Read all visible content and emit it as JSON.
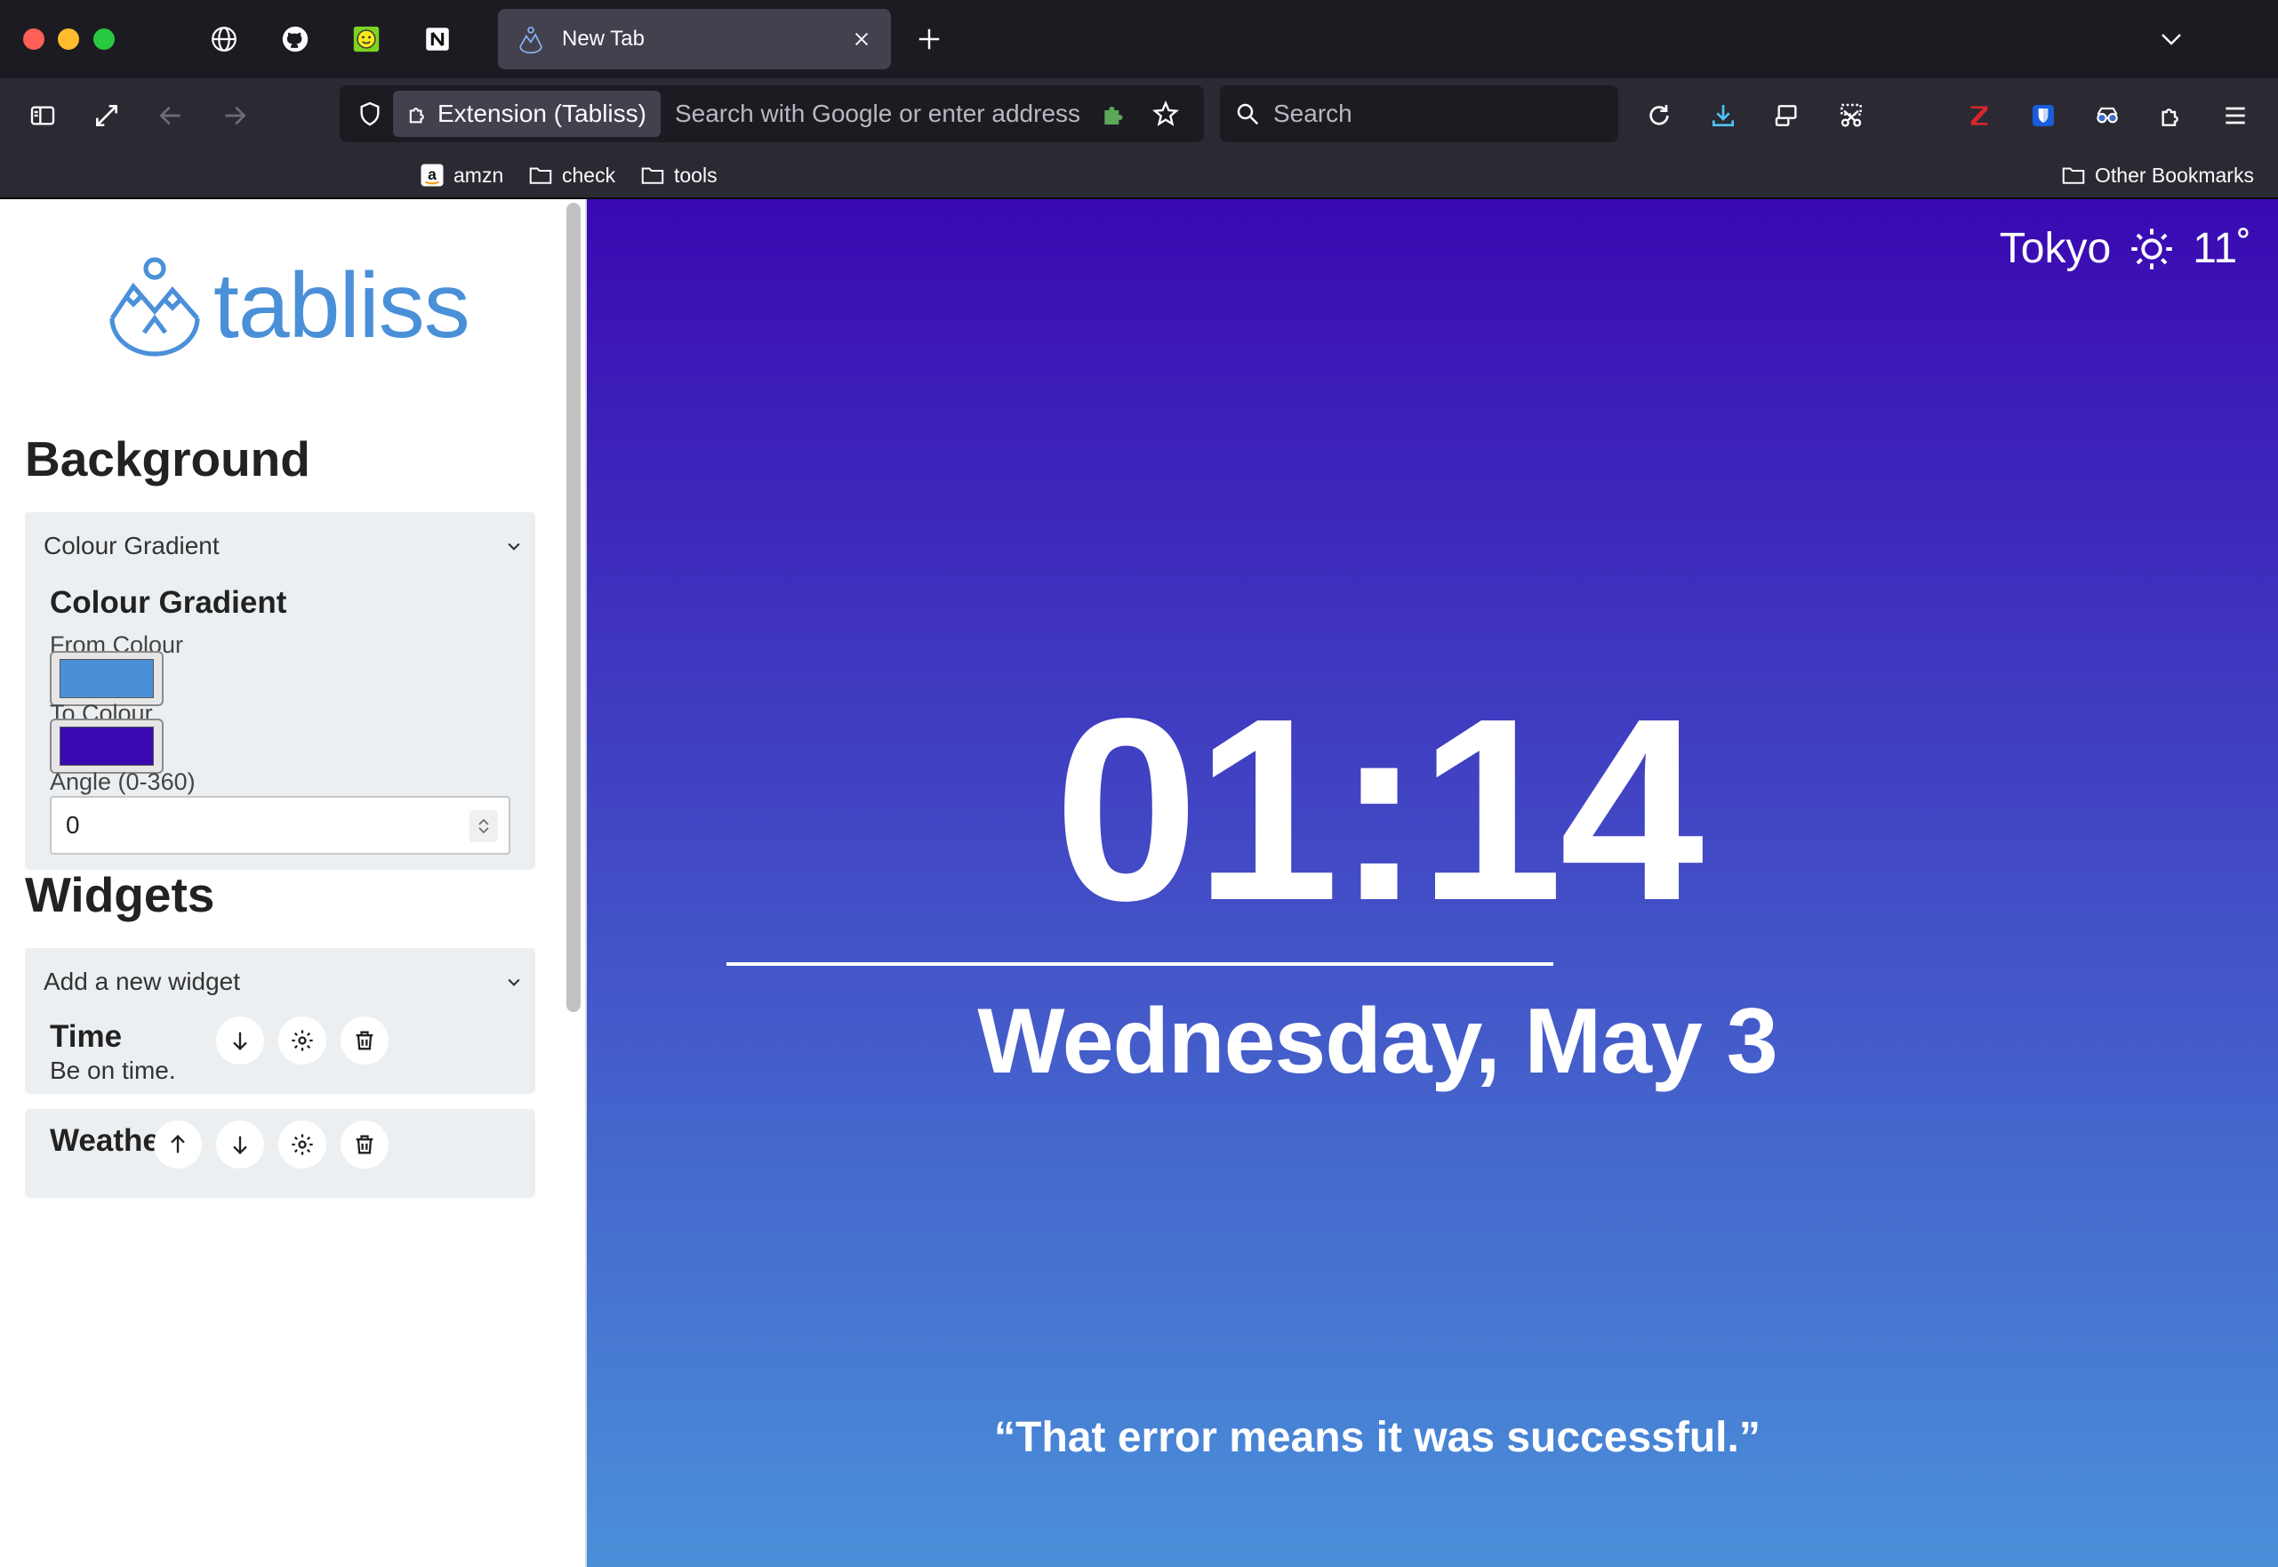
{
  "browser": {
    "tab_title": "New Tab",
    "url_identity": "Extension (Tabliss)",
    "url_placeholder": "Search with Google or enter address",
    "search_placeholder": "Search",
    "bookmarks": [
      "amzn",
      "check",
      "tools"
    ],
    "other_bookmarks": "Other Bookmarks"
  },
  "settings": {
    "logo_text": "tabliss",
    "background_heading": "Background",
    "background_type": "Colour Gradient",
    "gradient": {
      "title": "Colour Gradient",
      "from_label": "From Colour",
      "from_colour": "#4a90d9",
      "to_label": "To Colour",
      "to_colour": "#3a09b2",
      "angle_label": "Angle (0-360)",
      "angle_value": "0"
    },
    "widgets_heading": "Widgets",
    "add_widget_placeholder": "Add a new widget",
    "widgets": [
      {
        "name": "Time",
        "description": "Be on time."
      },
      {
        "name": "Weather",
        "description": ""
      }
    ]
  },
  "dashboard": {
    "weather_city": "Tokyo",
    "weather_icon": "sun-icon",
    "weather_temp": "11˚",
    "time": "01:14",
    "date": "Wednesday, May 3",
    "quote": "“That error means it was successful.”"
  }
}
